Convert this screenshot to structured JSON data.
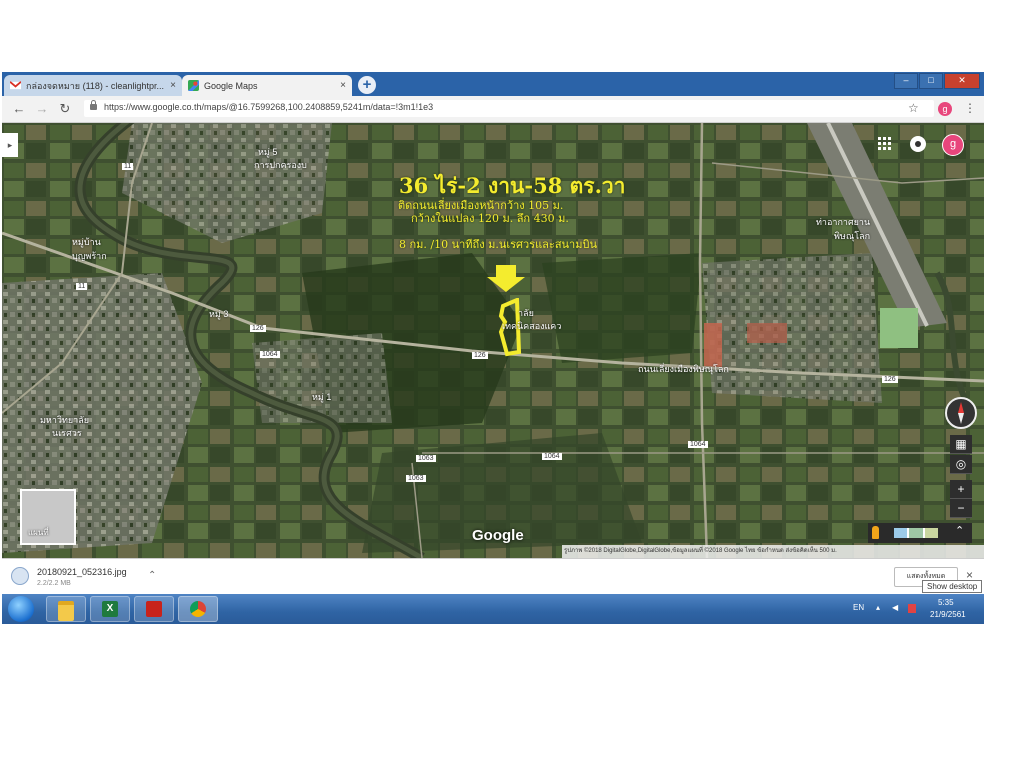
{
  "tabs": [
    {
      "title": "กล่องจดหมาย (118) - cleanlightpr...",
      "close": "×",
      "icon": "gmail-icon",
      "active": false
    },
    {
      "title": "Google Maps",
      "close": "×",
      "icon": "google-maps-icon",
      "active": true
    }
  ],
  "new_tab_label": "+",
  "window_controls": {
    "minimize": "–",
    "maximize": "□",
    "close": "✕"
  },
  "toolbar": {
    "url": "https://www.google.co.th/maps/@16.7599268,100.2408859,5241m/data=!3m1!1e3",
    "profile_initial": "g"
  },
  "map": {
    "profile_initial": "g",
    "annotation": {
      "title": "36 ไร่-2 งาน-58 ตร.วา",
      "line1": "ติดถนนเลี่ยงเมืองหน้ากว้าง 105 ม.",
      "line2": "กว้างในแปลง 120 ม. ลึก 430 ม.",
      "line3": "8 กม. /10 นาทีถึง ม.นเรศวรและสนามบิน"
    },
    "place_labels": [
      {
        "text": "หมู่ 5",
        "id": "moo5"
      },
      {
        "text": "การปกครองบ",
        "id": "admin"
      },
      {
        "text": "หมู่บ้าน",
        "id": "village"
      },
      {
        "text": "บุญพร้าก",
        "id": "bunphrak"
      },
      {
        "text": "หมู่ 3",
        "id": "moo3"
      },
      {
        "text": "หมู่ 1",
        "id": "moo1"
      },
      {
        "text": "มหาวิทยาลัย",
        "id": "univ1"
      },
      {
        "text": "นเรศวร",
        "id": "univ2"
      },
      {
        "text": "ท่าอากาศยาน",
        "id": "airport1"
      },
      {
        "text": "พิษณุโลก",
        "id": "airport2"
      },
      {
        "text": "าลัย",
        "id": "college1"
      },
      {
        "text": "เทคนิคสองแคว",
        "id": "college2"
      },
      {
        "text": "ถนนเลี่ยงเมืองพิษณุโลก",
        "id": "road"
      }
    ],
    "route_shields": [
      "11",
      "11",
      "1064",
      "126",
      "126",
      "126",
      "1063",
      "1063",
      "1064",
      "1064"
    ],
    "layers_label": "แผนที่",
    "controls": {
      "zoom_in": "+",
      "zoom_out": "−",
      "expand": "⌃"
    },
    "google_logo": "Google",
    "attribution": "รูปภาพ ©2018 DigitalGlobe,DigitalGlobe,ข้อมูลแผนที่ ©2018 Google   ไทย   ข้อกำหนด   ส่งข้อคิดเห็น   500 ม."
  },
  "download": {
    "filename": "20180921_052316.jpg",
    "size": "2.2/2.2 MB",
    "show_all": "แสดงทั้งหมด",
    "close": "×"
  },
  "tooltip": "Show desktop",
  "taskbar": {
    "apps": [
      "explorer-icon",
      "excel-icon",
      "acrobat-icon",
      "chrome-icon"
    ],
    "lang": "EN",
    "time": "5:35",
    "date": "21/9/2561"
  },
  "colors": {
    "annotation": "#f4ec2e",
    "titlebar": "#2b63a8",
    "taskbar": "#2f64a4"
  }
}
